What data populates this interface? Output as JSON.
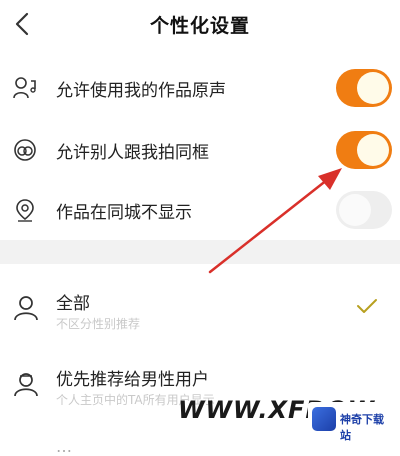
{
  "header": {
    "title": "个性化设置"
  },
  "settings": [
    {
      "label": "允许使用我的作品原声",
      "icon": "user-voice-icon",
      "on": true
    },
    {
      "label": "允许别人跟我拍同框",
      "icon": "duet-icon",
      "on": true
    },
    {
      "label": "作品在同城不显示",
      "icon": "location-pin-icon",
      "on": false
    }
  ],
  "options": [
    {
      "label": "全部",
      "sub": "不区分性别推荐",
      "icon": "person-icon",
      "selected": true
    },
    {
      "label": "优先推荐给男性用户",
      "sub": "个人主页中的TA所有用户显示",
      "icon": "male-user-icon",
      "selected": false
    }
  ],
  "watermark": {
    "text": "WWW.XFDOW",
    "logo_text": "神奇下载站"
  },
  "colors": {
    "accent": "#f07d12",
    "arrow": "#d9302a",
    "check": "#b8a020"
  }
}
